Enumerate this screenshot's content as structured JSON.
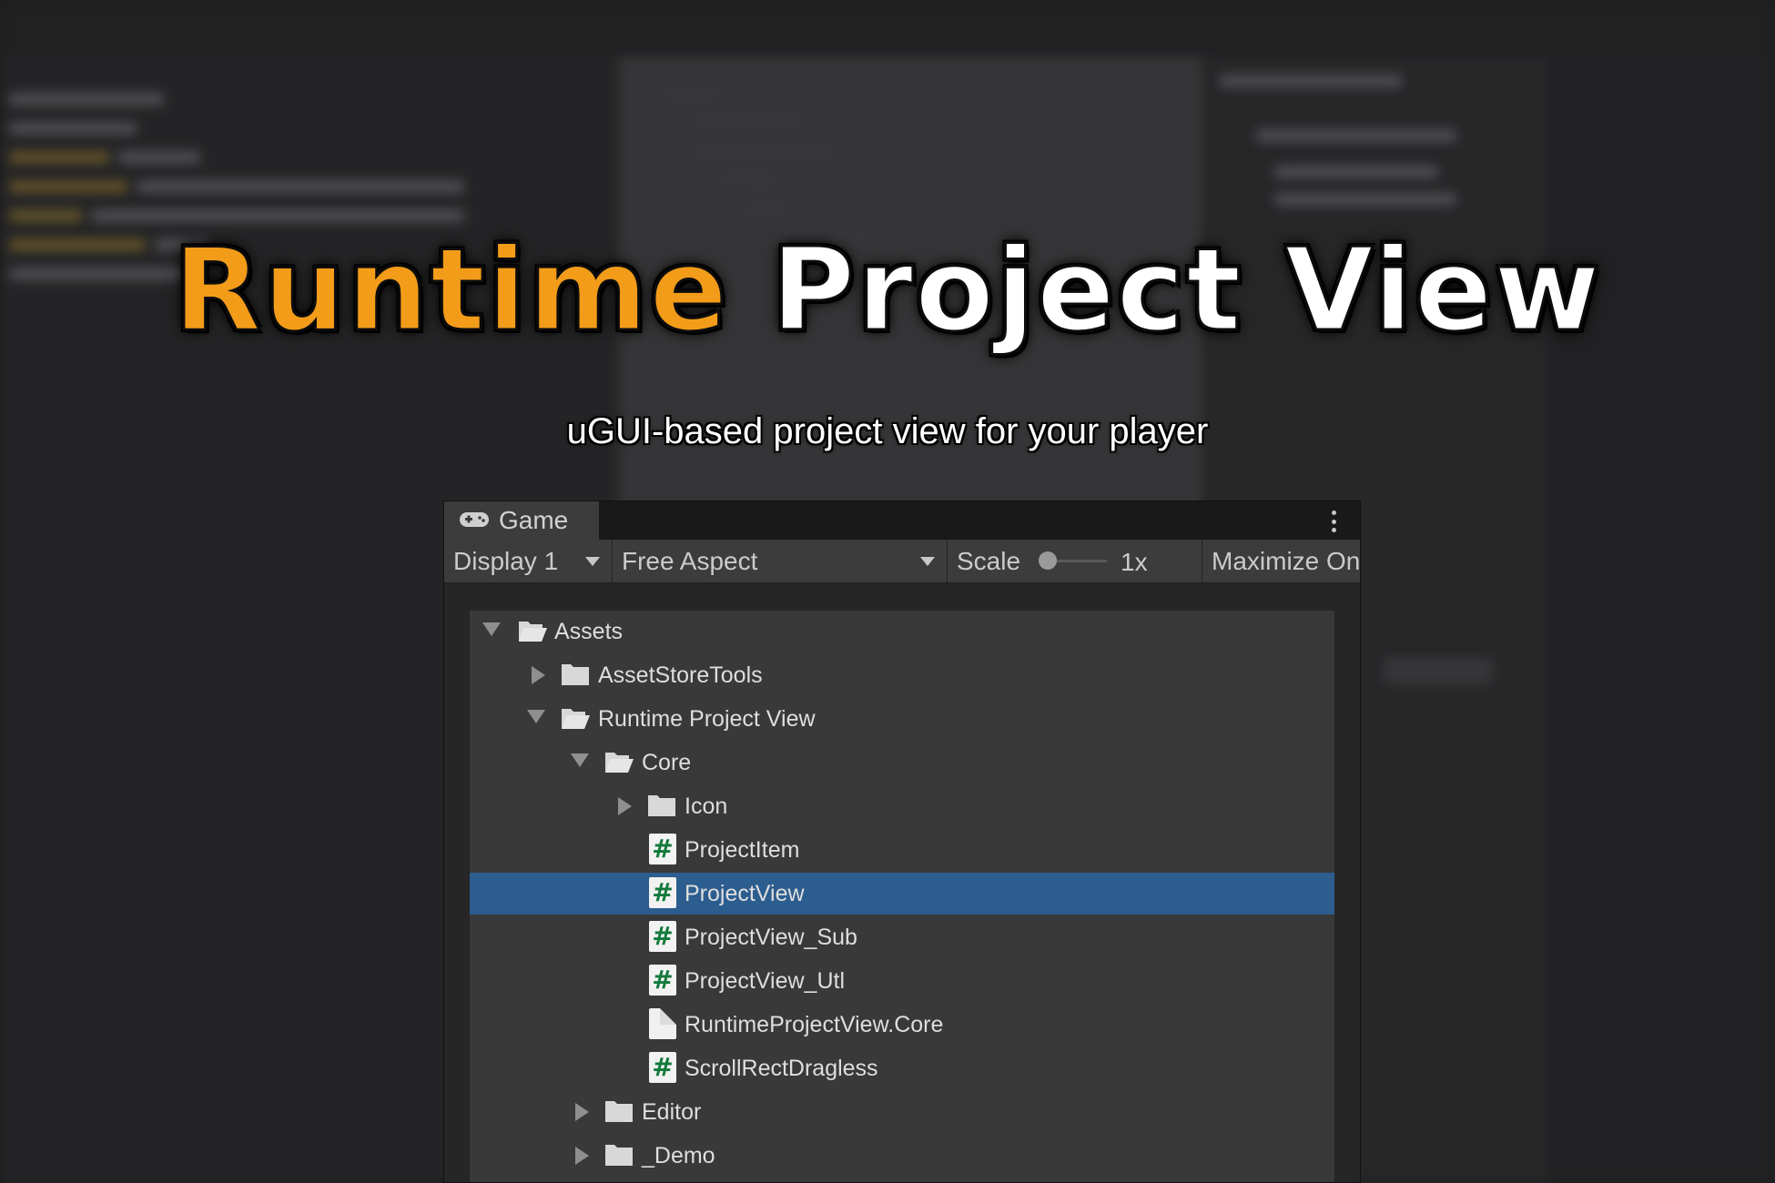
{
  "hero": {
    "title_part1": "Runtime",
    "title_part2": "Project View",
    "subtitle": "uGUI-based project view for your player"
  },
  "colors": {
    "title_accent": "#f39c1a",
    "selection": "#2c5d8f",
    "script_icon": "#127a3b"
  },
  "game_window": {
    "tab_label": "Game",
    "tab_icon": "gamepad-icon",
    "display_label": "Display 1",
    "aspect_label": "Free Aspect",
    "scale_label": "Scale",
    "scale_value": "1x",
    "maximize_label": "Maximize On"
  },
  "tree": {
    "items": [
      {
        "label": "Assets",
        "icon": "folder-open-icon",
        "expanded": true
      },
      {
        "label": "AssetStoreTools",
        "icon": "folder-icon",
        "expanded": false
      },
      {
        "label": "Runtime Project View",
        "icon": "folder-open-icon",
        "expanded": true
      },
      {
        "label": "Core",
        "icon": "folder-open-icon",
        "expanded": true
      },
      {
        "label": "Icon",
        "icon": "folder-icon",
        "expanded": false
      },
      {
        "label": "ProjectItem",
        "icon": "csharp-script-icon"
      },
      {
        "label": "ProjectView",
        "icon": "csharp-script-icon",
        "selected": true
      },
      {
        "label": "ProjectView_Sub",
        "icon": "csharp-script-icon"
      },
      {
        "label": "ProjectView_Utl",
        "icon": "csharp-script-icon"
      },
      {
        "label": "RuntimeProjectView.Core",
        "icon": "file-icon"
      },
      {
        "label": "ScrollRectDragless",
        "icon": "csharp-script-icon"
      },
      {
        "label": "Editor",
        "icon": "folder-icon",
        "expanded": false
      },
      {
        "label": "_Demo",
        "icon": "folder-icon",
        "expanded": false
      }
    ]
  }
}
